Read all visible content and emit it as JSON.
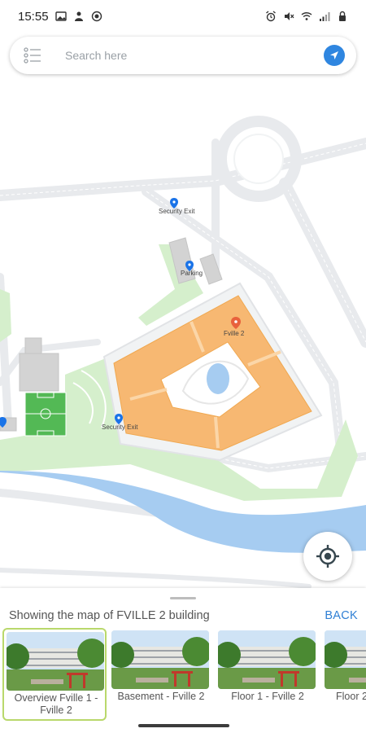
{
  "status_bar": {
    "time": "15:55"
  },
  "search": {
    "placeholder": "Search here"
  },
  "map": {
    "labels": {
      "security_top": "Security Exit",
      "parking": "Parking",
      "building": "Fville 2",
      "security_bottom": "Security Exit"
    },
    "colors": {
      "water": "#a6ccf1",
      "building": "#f7b872",
      "green": "#d5efcc",
      "field": "#53b955",
      "road": "#e9ecef"
    }
  },
  "sheet": {
    "title": "Showing the map of FVILLE 2 building",
    "back_label": "BACK",
    "floors": [
      {
        "label": "Overview Fville 1 - Fville 2",
        "selected": true
      },
      {
        "label": "Basement - Fville 2",
        "selected": false
      },
      {
        "label": "Floor 1 - Fville 2",
        "selected": false
      },
      {
        "label": "Floor 2",
        "selected": false
      }
    ]
  }
}
